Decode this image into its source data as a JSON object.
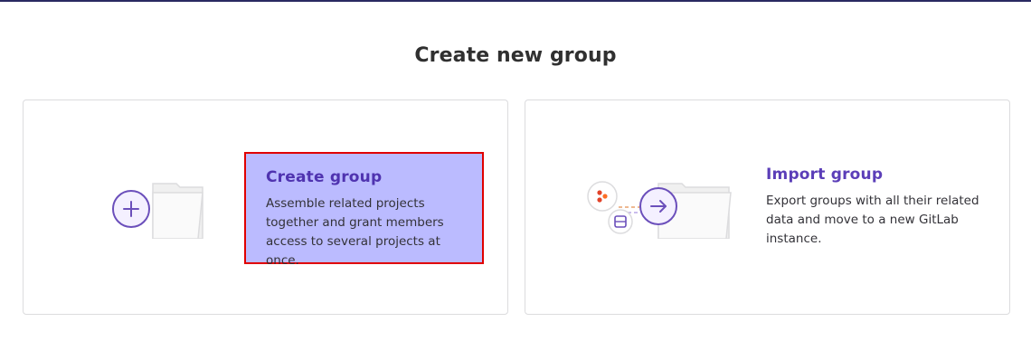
{
  "page": {
    "title": "Create new group"
  },
  "create_group": {
    "title": "Create group",
    "description": "Assemble related projects together and grant members access to several projects at once."
  },
  "import_group": {
    "title": "Import group",
    "description": "Export groups with all their related data and move to a new GitLab instance."
  },
  "colors": {
    "accent": "#5b3eb8",
    "highlight_fill": "#bbbbff",
    "highlight_border": "#e00000",
    "top_bar": "#292961",
    "icon_orange": "#e24329"
  }
}
